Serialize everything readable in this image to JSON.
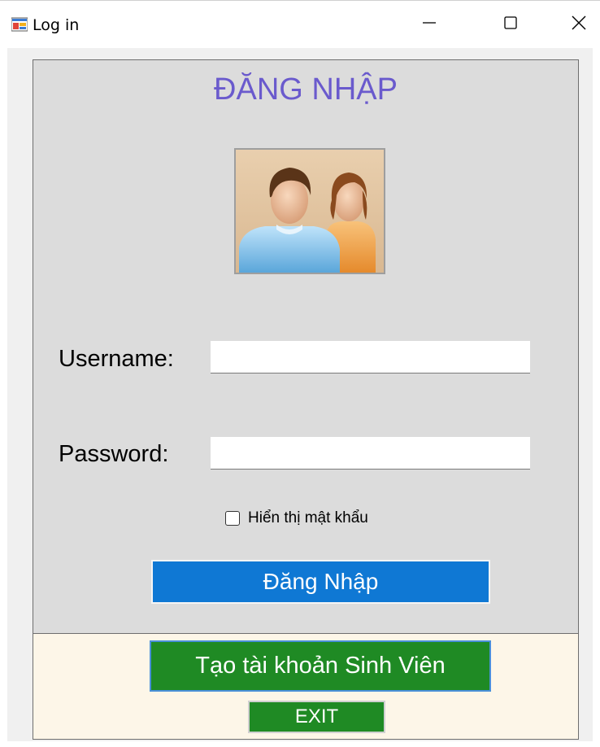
{
  "window": {
    "title": "Log in",
    "minimize_icon": "minimize-icon",
    "maximize_icon": "maximize-icon",
    "close_icon": "close-icon",
    "app_icon": "app-form-icon"
  },
  "form": {
    "heading": "ĐĂNG NHẬP",
    "heading_color": "#6a5acd",
    "avatar_icon": "users-avatar-icon",
    "username_label": "Username:",
    "username_value": "",
    "password_label": "Password:",
    "password_value": "",
    "show_password_label": "Hiển thị mật khẩu",
    "show_password_checked": false,
    "login_button": "Đăng Nhập",
    "login_button_color": "#0f78d4"
  },
  "footer": {
    "create_account_button": "Tạo tài khoản Sinh Viên",
    "exit_button": "EXIT",
    "button_color": "#1f8a24",
    "panel_color": "#fdf6e8"
  }
}
